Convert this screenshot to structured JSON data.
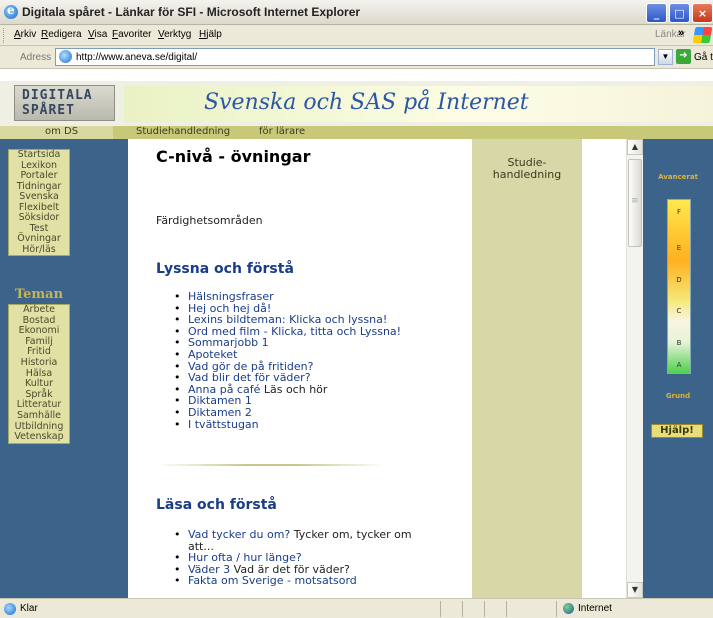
{
  "window": {
    "title": "Digitala spåret - Länkar för SFI - Microsoft Internet Explorer",
    "minimize": "_",
    "maximize": "□",
    "close": "×"
  },
  "menubar": {
    "items": [
      "Arkiv",
      "Redigera",
      "Visa",
      "Favoriter",
      "Verktyg",
      "Hjälp"
    ],
    "links_label": "Länkar",
    "links_chevron": "»"
  },
  "addressbar": {
    "label": "Adress",
    "url": "http://www.aneva.se/digital/",
    "go_label": "Gå till"
  },
  "site": {
    "logo_line1": "DIGITALA",
    "logo_line2": "SPÅRET",
    "banner": "Svenska och SAS på Internet"
  },
  "nav": {
    "items": [
      "om DS",
      "Studiehandledning",
      "för lärare"
    ]
  },
  "left_menu": {
    "items": [
      "Startsida",
      "Lexikon",
      "Portaler",
      "Tidningar",
      "Svenska",
      "Flexibelt",
      "Söksidor",
      "Test",
      "Övningar",
      "Hör/läs"
    ],
    "teman_heading": "Teman",
    "teman": [
      "Arbete",
      "Bostad",
      "Ekonomi",
      "Familj",
      "Fritid",
      "Historia",
      "Hälsa",
      "Kultur",
      "Språk",
      "Litteratur",
      "Samhälle",
      "Utbildning",
      "Vetenskap"
    ]
  },
  "main": {
    "title": "C-nivå - övningar",
    "section_label": "Färdighetsområden",
    "sections": [
      {
        "heading": "Lyssna och förstå",
        "links": [
          {
            "text": "Hälsningsfraser",
            "suffix": ""
          },
          {
            "text": "Hej och hej då!",
            "suffix": ""
          },
          {
            "text": "Lexins bildteman: Klicka och lyssna!",
            "suffix": ""
          },
          {
            "text": "Ord med film - Klicka, titta och Lyssna!",
            "suffix": ""
          },
          {
            "text": "Sommarjobb 1",
            "suffix": ""
          },
          {
            "text": "Apoteket",
            "suffix": ""
          },
          {
            "text": "Vad gör de på fritiden?",
            "suffix": ""
          },
          {
            "text": "Vad blir det för väder?",
            "suffix": ""
          },
          {
            "text": "Anna på café",
            "suffix": " Läs och hör"
          },
          {
            "text": "Diktamen 1",
            "suffix": ""
          },
          {
            "text": "Diktamen 2",
            "suffix": ""
          },
          {
            "text": "I tvättstugan",
            "suffix": ""
          }
        ]
      },
      {
        "heading": "Läsa och förstå",
        "links": [
          {
            "text": "Vad tycker du om?",
            "suffix": " Tycker om, tycker om att..."
          },
          {
            "text": "Hur ofta / hur länge?",
            "suffix": ""
          },
          {
            "text": "Väder 3",
            "suffix": " Vad är det för väder?"
          },
          {
            "text": "Fakta om Sverige - motsatsord",
            "suffix": ""
          }
        ]
      }
    ]
  },
  "studie": {
    "label": "Studie-handledning"
  },
  "level_bar": {
    "top_label": "Avancerat",
    "bottom_label": "Grund",
    "levels": [
      "F",
      "E",
      "D",
      "C",
      "B",
      "A"
    ],
    "help": "Hjälp!"
  },
  "statusbar": {
    "status": "Klar",
    "zone": "Internet"
  },
  "colors": {
    "sidebar_blue": "#3c648a",
    "menu_khaki": "#e1e1a6",
    "link_blue": "#1a3d8a",
    "studie_khaki": "#d7d7a8",
    "nav_olive": "#c8c879"
  }
}
